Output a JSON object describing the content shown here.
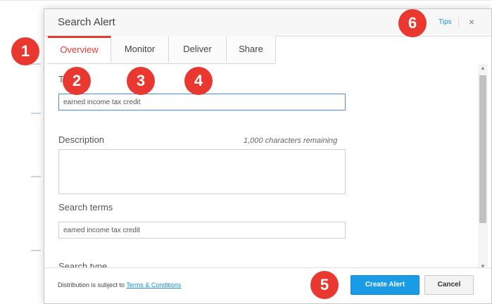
{
  "modal": {
    "title": "Search Alert",
    "tips": "Tips",
    "close": "×"
  },
  "tabs": [
    {
      "label": "Overview",
      "active": true
    },
    {
      "label": "Monitor",
      "active": false
    },
    {
      "label": "Deliver",
      "active": false
    },
    {
      "label": "Share",
      "active": false
    }
  ],
  "form": {
    "title_label": "T",
    "title_value": "earned income tax credit",
    "description_label": "Description",
    "description_counter": "1,000 characters remaining",
    "description_value": "",
    "search_terms_label": "Search terms",
    "search_terms_value": "eamed income tax credit",
    "search_type_label": "Search type"
  },
  "footer": {
    "notice_prefix": "Distribution is subject to ",
    "terms_link": "Terms & Conditions",
    "create_button": "Create Alert",
    "cancel_button": "Cancel"
  },
  "badges": [
    "1",
    "2",
    "3",
    "4",
    "5",
    "6"
  ],
  "colors": {
    "accent_red": "#e03c31",
    "primary_blue": "#1a9be6",
    "link_blue": "#1a8fd8",
    "badge_red": "#e8382f"
  },
  "icons": {
    "close": "close-icon",
    "scroll_up": "scroll-up-arrow-icon",
    "scroll_down": "scroll-down-arrow-icon"
  }
}
